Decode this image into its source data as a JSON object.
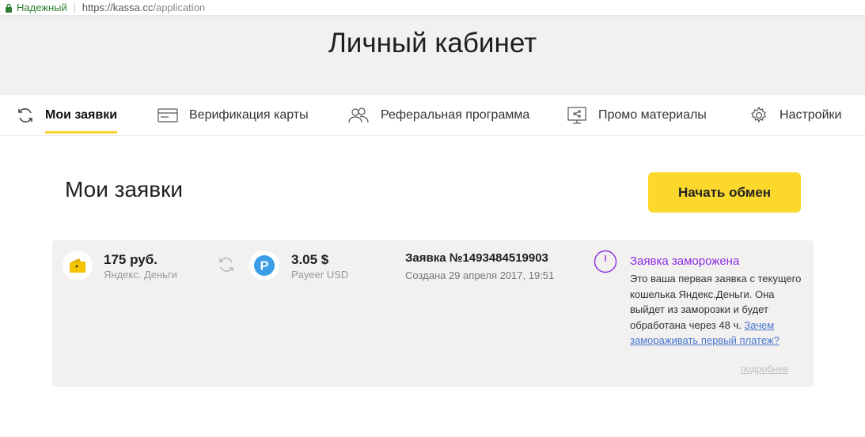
{
  "browser": {
    "secure_label": "Надежный",
    "url_host": "https://kassa.cc",
    "url_path": "/application"
  },
  "header": {
    "title": "Личный кабинет"
  },
  "tabs": [
    {
      "label": "Мои заявки",
      "icon": "refresh-icon",
      "active": true
    },
    {
      "label": "Верификация карты",
      "icon": "card-icon",
      "active": false
    },
    {
      "label": "Реферальная программа",
      "icon": "users-icon",
      "active": false
    },
    {
      "label": "Промо материалы",
      "icon": "monitor-share-icon",
      "active": false
    },
    {
      "label": "Настройки",
      "icon": "gear-icon",
      "active": false
    }
  ],
  "main": {
    "title": "Мои заявки",
    "start_button": "Начать обмен"
  },
  "order": {
    "from": {
      "amount": "175 руб.",
      "system": "Яндекс. Деньги",
      "icon": "yandex-money-icon"
    },
    "to": {
      "amount": "3.05 $",
      "system": "Payeer USD",
      "icon": "payeer-icon"
    },
    "number": "Заявка №1493484519903",
    "created": "Создана 29 апреля 2017, 19:51",
    "status": {
      "title": "Заявка заморожена",
      "text": "Это ваша первая заявка с текущего кошелька Яндекс.Деньги. Она выйдет из заморозки и будет обработана через 48 ч.",
      "link": "Зачем замораживать первый платеж?",
      "icon": "clock-icon"
    },
    "more_link": "подробнее"
  },
  "colors": {
    "accent": "#fcd82d",
    "status_purple": "#8b2be2",
    "link_blue": "#4a76d1",
    "secure_green": "#2e7d32"
  }
}
